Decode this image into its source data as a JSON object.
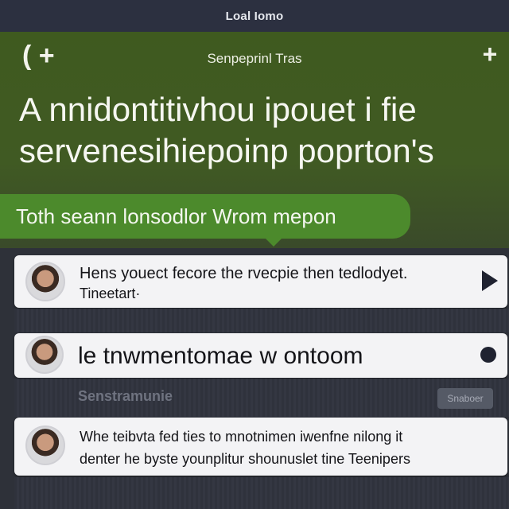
{
  "topbar": {
    "title": "Loal Iomo"
  },
  "header": {
    "subtitle": "Senpeprinl Tras",
    "headline_line1": "A nnidontitivhou ipouet i fie",
    "headline_line2": "servenesihiepoinp poprton's",
    "back_icon": "back-add-icon",
    "add_icon": "plus-icon"
  },
  "pill": {
    "label": "Toth seann lonsodlor Wrom mepon"
  },
  "cards": [
    {
      "line1": "Hens youect fecore the rvecpie then tedlodyet.",
      "line2": "Tineetart·",
      "action_icon": "play-icon"
    },
    {
      "line1": "le tnwmentomae w ontoom",
      "action_icon": "dot-icon"
    },
    {
      "line1": "Whe teibvta fed ties to mnotnimen iwenfne nilong it",
      "line2": "denter he byste younplitur shounuslet tine Teenipers"
    }
  ],
  "strip": {
    "left_label": "Senstramunie",
    "button_label": "Snaboer"
  },
  "colors": {
    "header": "#405a23",
    "pill": "#4c8a2c",
    "topbar": "#2c3040",
    "background": "#2e3139",
    "card": "#f3f3f5"
  }
}
